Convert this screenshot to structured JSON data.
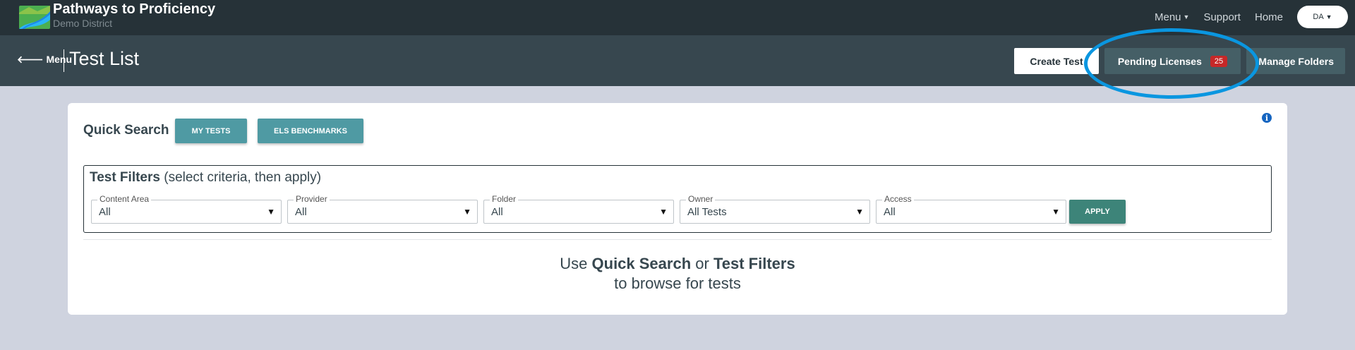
{
  "brand": {
    "title": "Pathways to Proficiency",
    "subtitle": "Demo District",
    "logo_icon": "landscape-road-logo"
  },
  "topnav": {
    "menu_label": "Menu",
    "support_label": "Support",
    "home_label": "Home",
    "user_initials": "DA"
  },
  "header": {
    "back_label": "Menu",
    "page_title": "Test List",
    "create_test_label": "Create Test",
    "pending_licenses_label": "Pending Licenses",
    "pending_licenses_count": "25",
    "manage_folders_label": "Manage Folders"
  },
  "quick_search": {
    "title": "Quick Search",
    "buttons": [
      "MY TESTS",
      "ELS BENCHMARKS"
    ]
  },
  "filters": {
    "title_bold": "Test Filters",
    "title_rest": "(select criteria, then apply)",
    "fields": [
      {
        "label": "Content Area",
        "value": "All"
      },
      {
        "label": "Provider",
        "value": "All"
      },
      {
        "label": "Folder",
        "value": "All"
      },
      {
        "label": "Owner",
        "value": "All Tests"
      },
      {
        "label": "Access",
        "value": "All"
      }
    ],
    "apply_label": "APPLY"
  },
  "empty_state": {
    "line1_pre": "Use",
    "line1_b1": "Quick Search",
    "line1_mid": "or",
    "line1_b2": "Test Filters",
    "line2": "to browse for tests"
  },
  "colors": {
    "topbar": "#263238",
    "subbar": "#37474f",
    "accent_teal": "#4f9aa3",
    "apply_green": "#3d8479",
    "badge_red": "#c62828",
    "highlight": "#0a96e0"
  }
}
